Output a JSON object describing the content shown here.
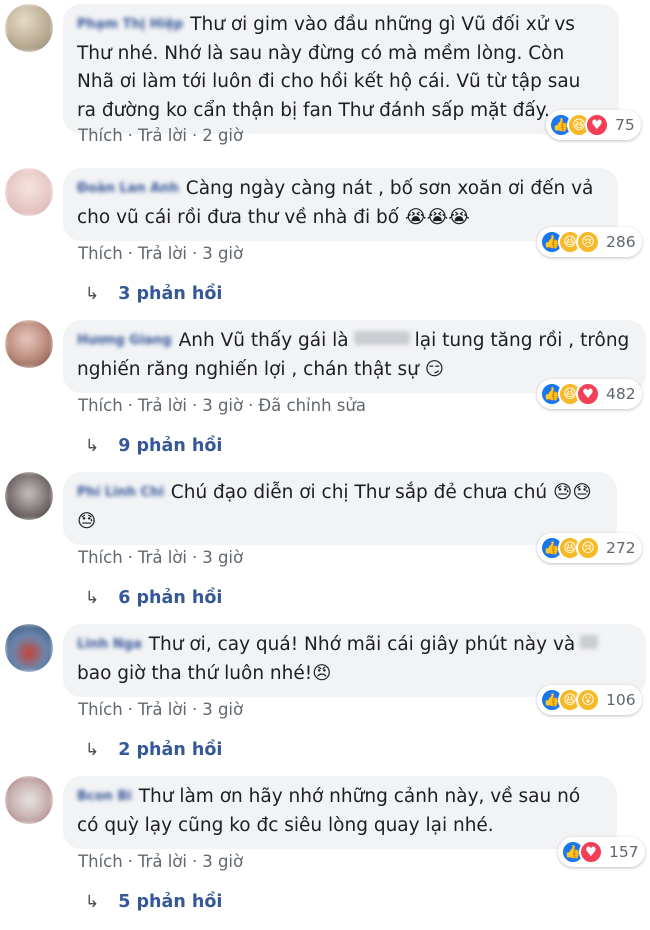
{
  "labels": {
    "like": "Thích",
    "reply": "Trả lời",
    "edited": "Đã chỉnh sửa"
  },
  "comments": [
    {
      "author": "Phạm Thị Hiệp",
      "text": "Thư ơi gim vào đầu những gì Vũ đối xử vs Thư nhé. Nhớ là sau này đừng có mà mềm lòng. Còn Nhã ơi làm tới luôn đi cho hồi kết hộ cái. Vũ từ tập sau ra đường ko cẩn thận bị fan Thư đánh sấp mặt đấy.",
      "time": "2 giờ",
      "reactions": [
        "like",
        "haha",
        "love"
      ],
      "reaction_count": "75",
      "replies": ""
    },
    {
      "author": "Đoàn Lan Anh",
      "text": "Càng ngày càng nát , bố sơn xoăn ơi đến vả cho vũ cái rồi đưa thư về nhà đi bố 😭😭😭",
      "time": "3 giờ",
      "reactions": [
        "like",
        "haha",
        "sad"
      ],
      "reaction_count": "286",
      "replies": "3 phản hồi"
    },
    {
      "author": "Hương Giang",
      "text_before": "Anh Vũ thấy gái là",
      "text_after": "lại tung tăng rồi , trông nghiến răng nghiến lợi , chán thật sự 😏",
      "time": "3 giờ",
      "edited": true,
      "reactions": [
        "like",
        "haha",
        "love"
      ],
      "reaction_count": "482",
      "replies": "9 phản hồi"
    },
    {
      "author": "Phí Linh Chi",
      "text": "Chú đạo diễn ơi chị Thư sắp đẻ chưa chú 😓😓 😓",
      "time": "3 giờ",
      "reactions": [
        "like",
        "haha",
        "sad"
      ],
      "reaction_count": "272",
      "replies": "6 phản hồi"
    },
    {
      "author": "Linh Nga",
      "text_before": "Thư ơi, cay quá! Nhớ mãi cái giây phút này và",
      "text_after": "bao giờ tha thứ luôn nhé!😠",
      "time": "3 giờ",
      "reactions": [
        "like",
        "haha",
        "wow"
      ],
      "reaction_count": "106",
      "replies": "2 phản hồi"
    },
    {
      "author": "Bcon Bi",
      "text": "Thư làm ơn hãy nhớ những cảnh này, về sau nó có quỳ lạy cũng ko đc siêu lòng quay lại nhé.",
      "time": "3 giờ",
      "reactions": [
        "like",
        "love"
      ],
      "reaction_count": "157",
      "replies": "5 phản hồi"
    }
  ],
  "reaction_icons": {
    "like": "thumbs-up-icon",
    "love": "heart-icon",
    "haha": "laughing-face-icon",
    "sad": "sad-face-icon",
    "wow": "wow-face-icon"
  },
  "colors": {
    "bubble": "#f2f3f5",
    "link": "#385898",
    "meta": "#606770",
    "like": "#1877f2",
    "love": "#f33e58",
    "emoji": "#f7b928"
  }
}
